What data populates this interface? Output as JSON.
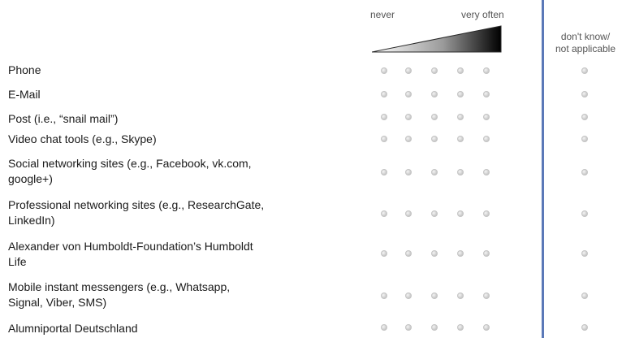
{
  "scale": {
    "low_label": "never",
    "high_label": "very often",
    "options_count": 5
  },
  "dont_know": {
    "line1": "don't know/",
    "line2": "not applicable"
  },
  "rows": [
    {
      "id": "phone",
      "lines": [
        "Phone"
      ]
    },
    {
      "id": "email",
      "lines": [
        "E-Mail"
      ]
    },
    {
      "id": "post",
      "lines": [
        "Post (i.e., “snail mail”)"
      ]
    },
    {
      "id": "video-chat",
      "lines": [
        "Video chat tools (e.g., Skype)"
      ]
    },
    {
      "id": "social-networking",
      "lines": [
        "Social networking sites (e.g., Facebook, vk.com,",
        "google+)"
      ]
    },
    {
      "id": "professional-networking",
      "lines": [
        "Professional networking sites (e.g., ResearchGate,",
        "LinkedIn)"
      ]
    },
    {
      "id": "humboldt-life",
      "lines": [
        "Alexander von Humboldt-Foundation’s Humboldt",
        "Life"
      ]
    },
    {
      "id": "instant-messengers",
      "lines": [
        "Mobile instant messengers (e.g., Whatsapp,",
        "Signal, Viber, SMS)"
      ]
    },
    {
      "id": "alumniportal",
      "lines": [
        "Alumniportal Deutschland"
      ]
    }
  ],
  "colors": {
    "divider": "#5b79b8",
    "radio": "#d2d2d2",
    "wedge_dark": "#000000",
    "wedge_light": "#ffffff"
  }
}
